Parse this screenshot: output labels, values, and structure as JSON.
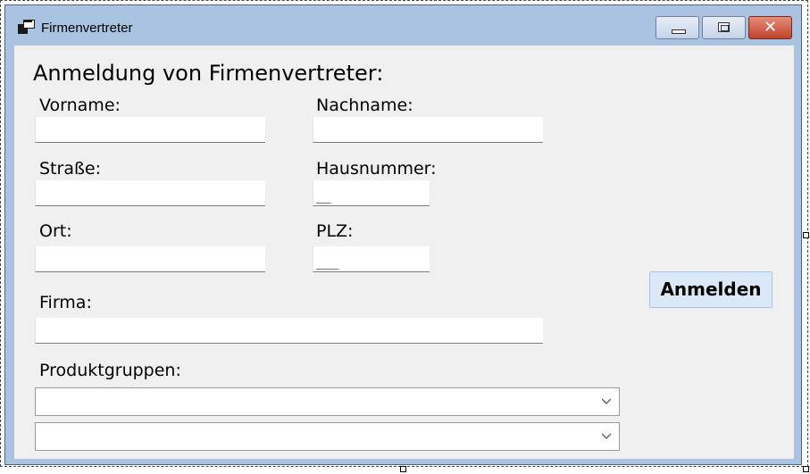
{
  "window": {
    "title": "Firmenvertreter"
  },
  "titlebar_icons": {
    "app": "app-icon",
    "minimize": "minimize-icon",
    "maximize": "maximize-icon",
    "close": "close-icon"
  },
  "form": {
    "heading": "Anmeldung von Firmenvertreter:",
    "labels": {
      "vorname": "Vorname:",
      "nachname": "Nachname:",
      "strasse": "Straße:",
      "hausnummer": "Hausnummer:",
      "ort": "Ort:",
      "plz": "PLZ:",
      "firma": "Firma:",
      "produktgruppen": "Produktgruppen:"
    },
    "values": {
      "vorname": "",
      "nachname": "",
      "strasse": "",
      "hausnummer": "__",
      "ort": "",
      "plz": "___",
      "firma": "",
      "produktgruppe1": "",
      "produktgruppe2": ""
    },
    "submit_label": "Anmelden"
  },
  "colors": {
    "titlebar": "#a9c3e0",
    "client": "#f0f0f0",
    "close_button": "#c0422c",
    "submit_button": "#dae8f7"
  }
}
